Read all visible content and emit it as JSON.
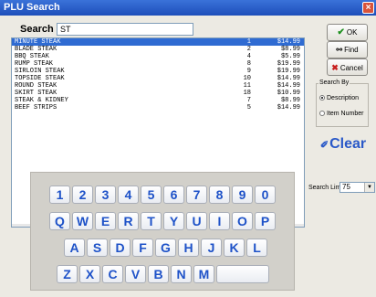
{
  "window": {
    "title": "PLU Search",
    "close_symbol": "×"
  },
  "search": {
    "label": "Search",
    "value": "ST"
  },
  "results": [
    {
      "name": "MINUTE STEAK",
      "code": "1",
      "price": "$14.99",
      "selected": true
    },
    {
      "name": "BLADE STEAK",
      "code": "2",
      "price": "$8.99"
    },
    {
      "name": "BBQ STEAK",
      "code": "4",
      "price": "$5.99"
    },
    {
      "name": "RUMP STEAK",
      "code": "8",
      "price": "$19.99"
    },
    {
      "name": "SIRLOIN STEAK",
      "code": "9",
      "price": "$19.99"
    },
    {
      "name": "TOPSIDE STEAK",
      "code": "10",
      "price": "$14.99"
    },
    {
      "name": "ROUND STEAK",
      "code": "11",
      "price": "$14.99"
    },
    {
      "name": "SKIRT STEAK",
      "code": "18",
      "price": "$10.99"
    },
    {
      "name": "STEAK & KIDNEY",
      "code": "7",
      "price": "$8.99"
    },
    {
      "name": "BEEF STRIPS",
      "code": "5",
      "price": "$14.99"
    }
  ],
  "buttons": {
    "ok": "OK",
    "find": "Find",
    "cancel": "Cancel",
    "clear": "Clear"
  },
  "search_by": {
    "legend": "Search By",
    "options": [
      {
        "label": "Description",
        "checked": true
      },
      {
        "label": "Item Number",
        "checked": false
      }
    ]
  },
  "keyboard": {
    "rows": [
      [
        "1",
        "2",
        "3",
        "4",
        "5",
        "6",
        "7",
        "8",
        "9",
        "0"
      ],
      [
        "Q",
        "W",
        "E",
        "R",
        "T",
        "Y",
        "U",
        "I",
        "O",
        "P"
      ],
      [
        "A",
        "S",
        "D",
        "F",
        "G",
        "H",
        "J",
        "K",
        "L"
      ],
      [
        "Z",
        "X",
        "C",
        "V",
        "B",
        "N",
        "M"
      ]
    ]
  },
  "search_limit": {
    "label": "Search Limit",
    "value": "75"
  },
  "colors": {
    "accent": "#1e52c8",
    "selection": "#2f6bd2",
    "titlebar": "#2c62cf"
  }
}
